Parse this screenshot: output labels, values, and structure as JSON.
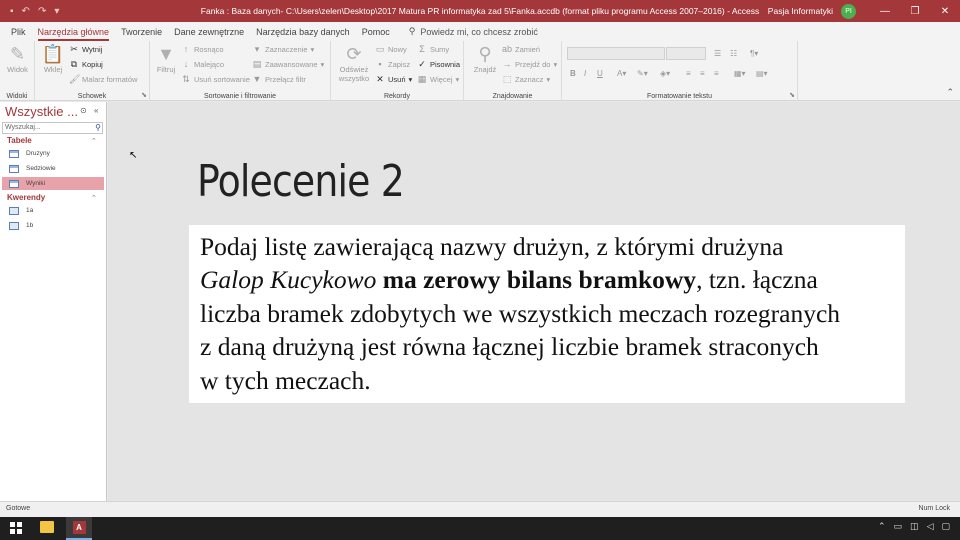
{
  "window": {
    "title": "Fanka : Baza danych- C:\\Users\\zelen\\Desktop\\2017 Matura PR informatyka zad 5\\Fanka.accdb (format pliku programu Access 2007–2016)  -  Access",
    "user_name": "Pasja Informatyki",
    "user_initials": "PI",
    "accent_color": "#a4373a"
  },
  "menu": {
    "tabs": [
      "Plik",
      "Narzędzia główne",
      "Tworzenie",
      "Dane zewnętrzne",
      "Narzędzia bazy danych",
      "Pomoc"
    ],
    "tell_me": "Powiedz mi, co chcesz zrobić"
  },
  "ribbon": {
    "widoki": {
      "view": "Widok",
      "label": "Widoki"
    },
    "schowek": {
      "paste": "Wklej",
      "cut": "Wytnij",
      "copy": "Kopiuj",
      "format_painter": "Malarz formatów",
      "label": "Schowek"
    },
    "sort": {
      "filter": "Filtruj",
      "asc": "Rosnąco",
      "desc": "Malejąco",
      "remove_sort": "Usuń sortowanie",
      "selection": "Zaznaczenie",
      "advanced": "Zaawansowane",
      "toggle_filter": "Przełącz filtr",
      "label": "Sortowanie i filtrowanie"
    },
    "rekordy": {
      "refresh": "Odśwież wszystko",
      "new": "Nowy",
      "save": "Zapisz",
      "delete": "Usuń",
      "totals": "Sumy",
      "spelling": "Pisownia",
      "more": "Więcej",
      "label": "Rekordy"
    },
    "znajdowanie": {
      "find": "Znajdź",
      "replace": "Zamień",
      "goto": "Przejdź do",
      "select": "Zaznacz",
      "label": "Znajdowanie"
    },
    "format": {
      "label": "Formatowanie tekstu"
    }
  },
  "nav": {
    "header": "Wszystkie ...",
    "search_placeholder": "Wyszukaj...",
    "tables_label": "Tabele",
    "tables": [
      "Druzyny",
      "Sedziowie",
      "Wyniki"
    ],
    "queries_label": "Kwerendy",
    "queries": [
      "1a",
      "1b"
    ]
  },
  "slide": {
    "title": "Polecenie 2",
    "p1": "Podaj listę zawierającą nazwy drużyn, z którymi drużyna",
    "p2_italic": "Galop Kucykowo",
    "p2_bold": "ma zerowy bilans bramkowy",
    "p2_rest": ", tzn. łączna",
    "p3": "liczba bramek zdobytych we wszystkich meczach rozegranych",
    "p4": "z daną drużyną jest równa łącznej liczbie bramek straconych",
    "p5": "w tych meczach."
  },
  "status": {
    "left": "Gotowe",
    "right": "Num Lock"
  }
}
